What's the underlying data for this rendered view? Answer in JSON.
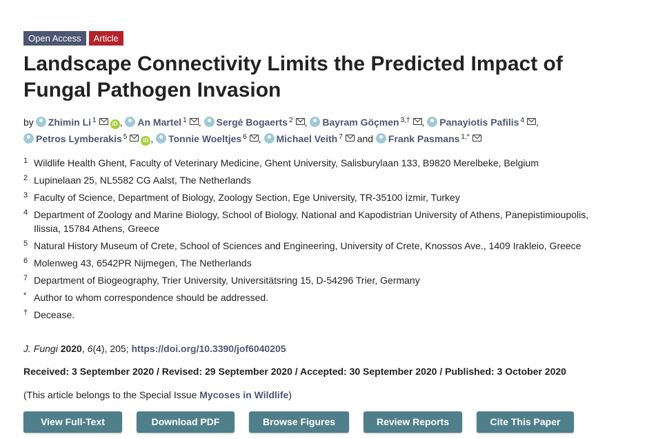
{
  "badges": {
    "open_access": "Open Access",
    "article": "Article"
  },
  "title": "Landscape Connectivity Limits the Predicted Impact of Fungal Pathogen Invasion",
  "authors": {
    "by": "by",
    "and": "and",
    "list": [
      {
        "name": "Zhimin Li",
        "sup": "1",
        "orcid": true
      },
      {
        "name": "An Martel",
        "sup": "1",
        "orcid": false
      },
      {
        "name": "Sergé Bogaerts",
        "sup": "2",
        "orcid": false
      },
      {
        "name": "Bayram Göçmen",
        "sup": "3,†",
        "orcid": false
      },
      {
        "name": "Panayiotis Pafilis",
        "sup": "4",
        "orcid": false
      },
      {
        "name": "Petros Lymberakis",
        "sup": "5",
        "orcid": true
      },
      {
        "name": "Tonnie Woeltjes",
        "sup": "6",
        "orcid": false
      },
      {
        "name": "Michael Veith",
        "sup": "7",
        "orcid": false
      },
      {
        "name": "Frank Pasmans",
        "sup": "1,*",
        "orcid": false
      }
    ]
  },
  "affiliations": [
    {
      "num": "1",
      "text": "Wildlife Health Ghent, Faculty of Veterinary Medicine, Ghent University, Salisburylaan 133, B9820 Merelbeke, Belgium"
    },
    {
      "num": "2",
      "text": "Lupinelaan 25, NL5582 CG Aalst, The Netherlands"
    },
    {
      "num": "3",
      "text": "Faculty of Science, Department of Biology, Zoology Section, Ege University, TR-35100 İzmir, Turkey"
    },
    {
      "num": "4",
      "text": "Department of Zoology and Marine Biology, School of Biology, National and Kapodistrian University of Athens, Panepistimioupolis, Ilissia, 15784 Athens, Greece"
    },
    {
      "num": "5",
      "text": "Natural History Museum of Crete, School of Sciences and Engineering, University of Crete, Knossos Ave., 1409 Irakleio, Greece"
    },
    {
      "num": "6",
      "text": "Molenweg 43, 6542PR Nijmegen, The Netherlands"
    },
    {
      "num": "7",
      "text": "Department of Biogeography, Trier University, Universitätsring 15, D-54296 Trier, Germany"
    },
    {
      "num": "*",
      "text": "Author to whom correspondence should be addressed."
    },
    {
      "num": "†",
      "text": "Decease."
    }
  ],
  "citation": {
    "journal": "J. Fungi",
    "year": "2020",
    "volume": "6",
    "issue": "(4)",
    "pages": ", 205; ",
    "doi": "https://doi.org/10.3390/jof6040205"
  },
  "dates": "Received: 3 September 2020 / Revised: 29 September 2020 / Accepted: 30 September 2020 / Published: 3 October 2020",
  "special_issue": {
    "prefix": "(This article belongs to the Special Issue ",
    "name": "Mycoses in Wildlife",
    "suffix": ")"
  },
  "buttons": [
    {
      "label": "View Full-Text",
      "name": "view-full-text-button"
    },
    {
      "label": "Download PDF",
      "name": "download-pdf-button"
    },
    {
      "label": "Browse Figures",
      "name": "browse-figures-button"
    },
    {
      "label": "Review Reports",
      "name": "review-reports-button"
    },
    {
      "label": "Cite This Paper",
      "name": "cite-this-paper-button"
    }
  ],
  "colors": {
    "accent": "#4f5671",
    "article_badge": "#b4232b",
    "button": "#4f7f8a",
    "orcid": "#a6ce39"
  },
  "icons": {
    "author": "person-icon",
    "email": "envelope-icon",
    "orcid": "orcid-icon"
  }
}
